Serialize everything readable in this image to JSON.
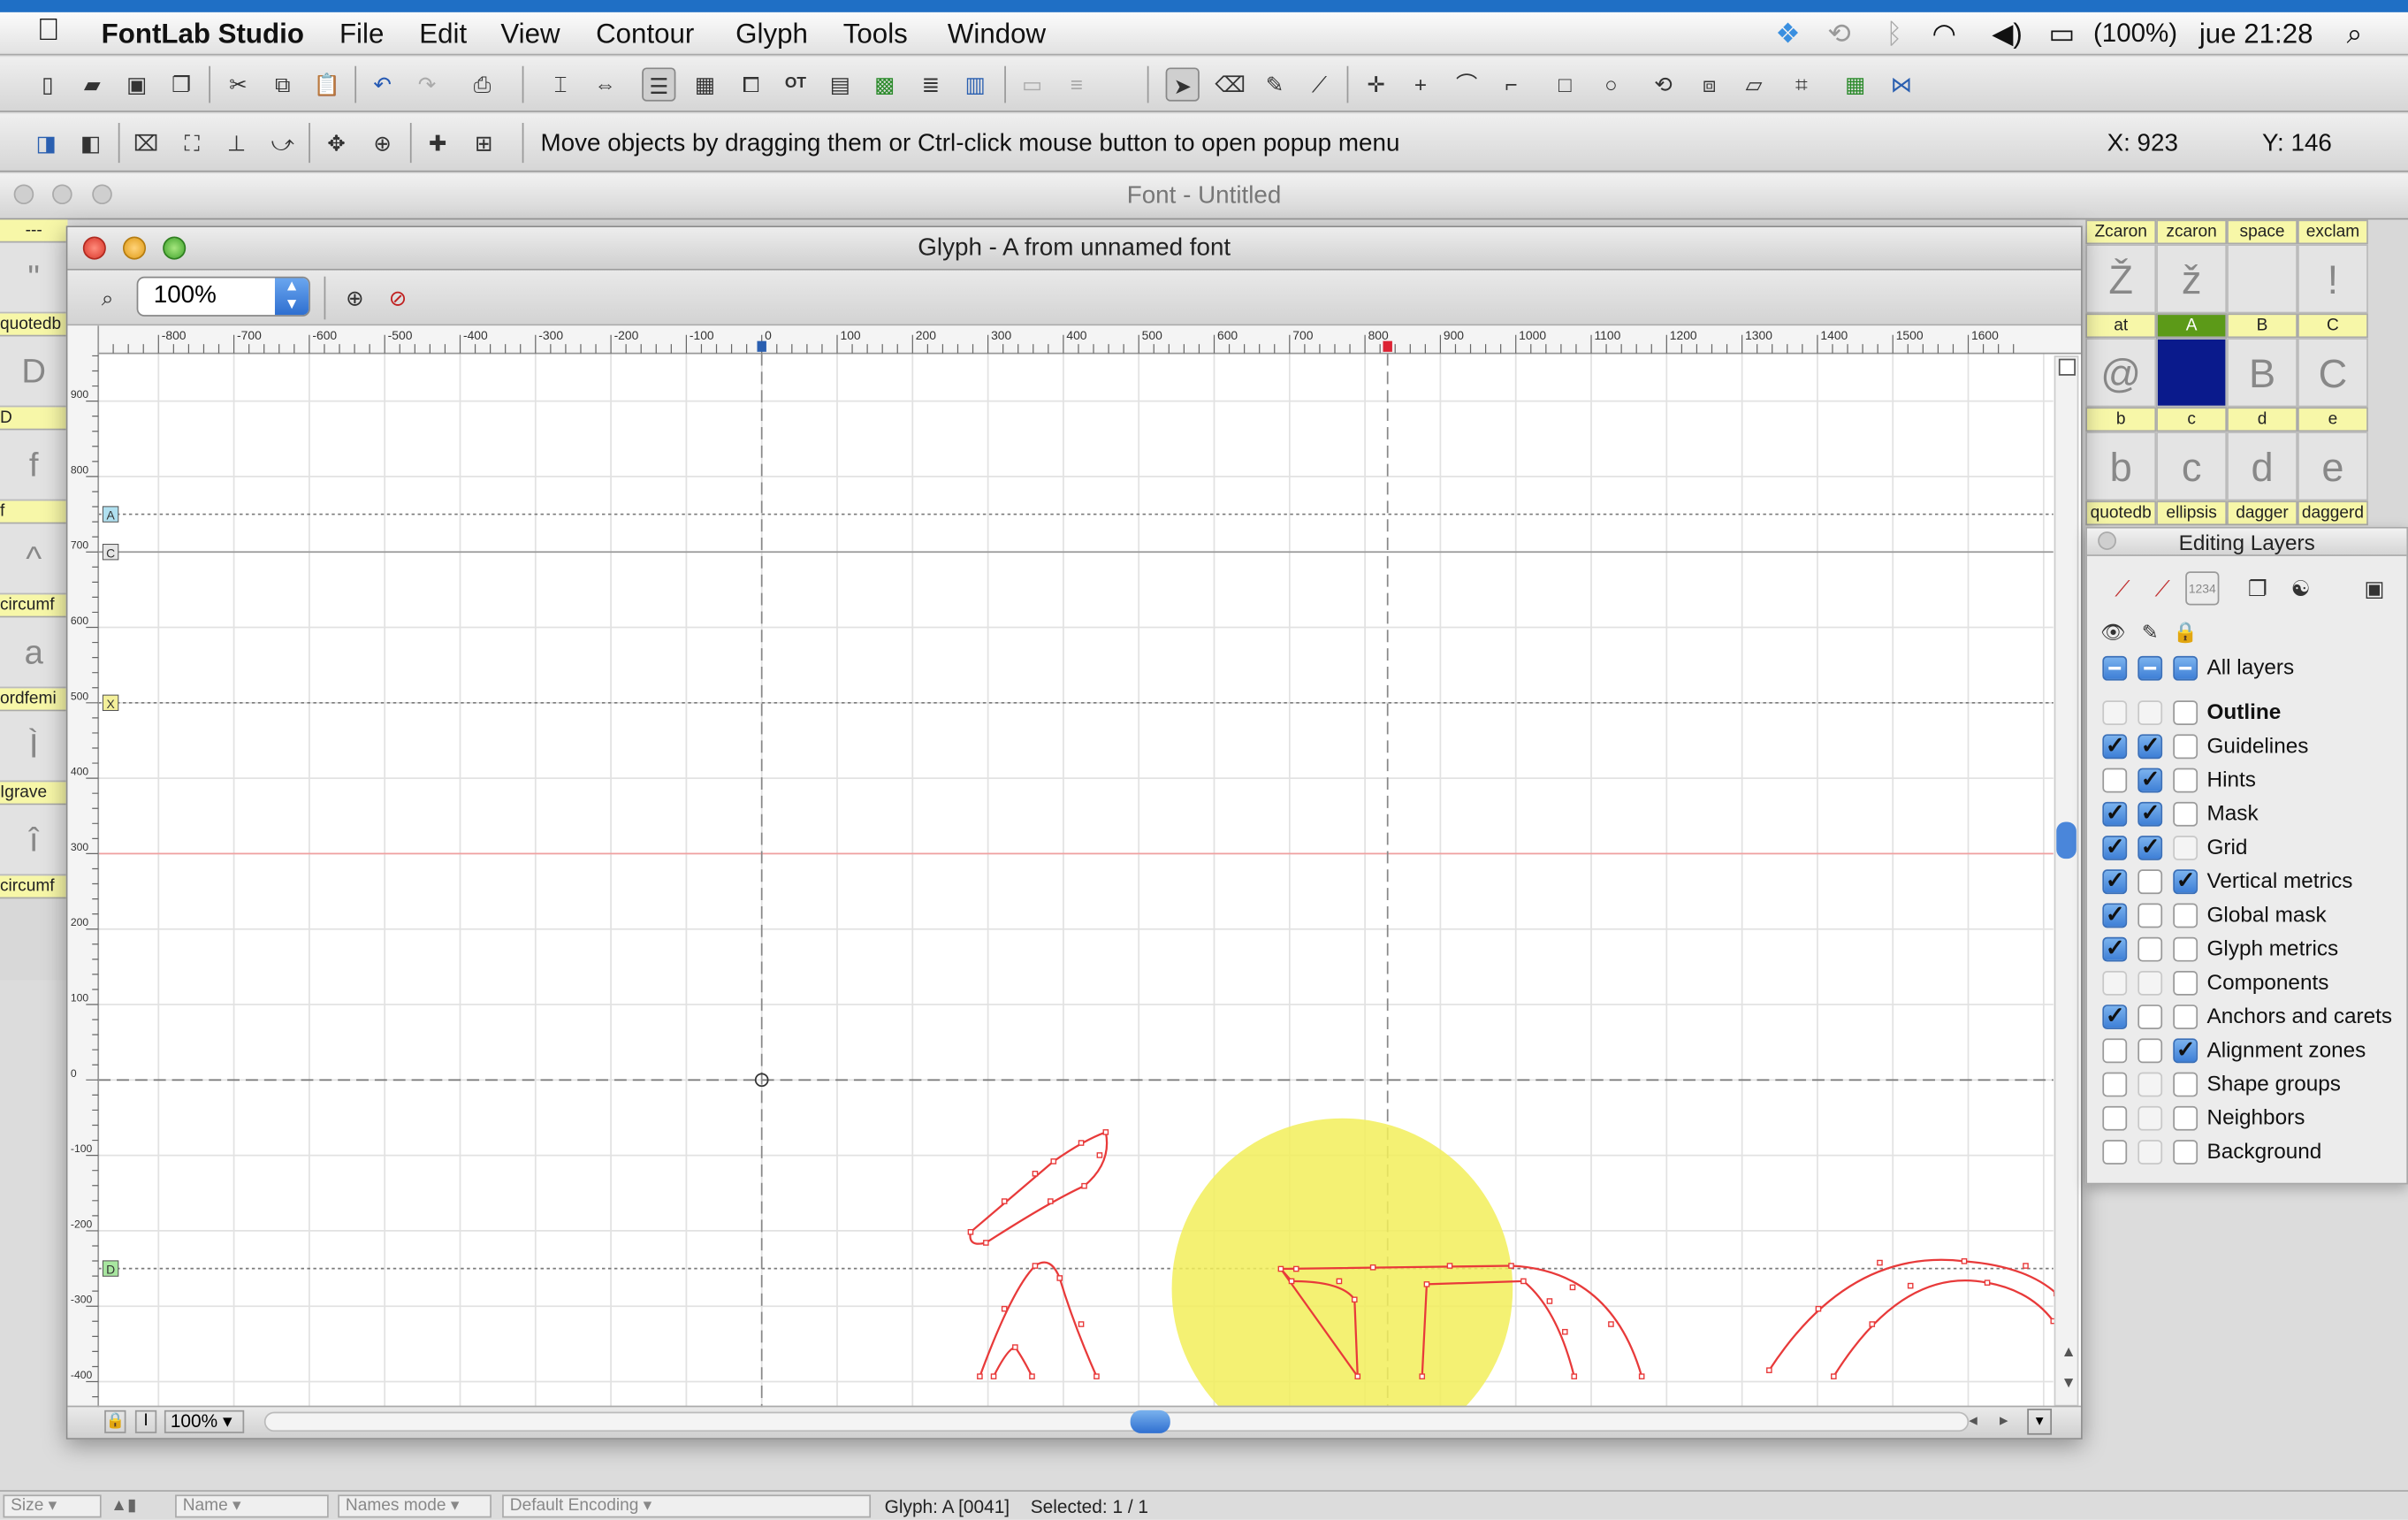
{
  "menubar": {
    "app": "FontLab Studio",
    "items": [
      "File",
      "Edit",
      "View",
      "Contour",
      "Glyph",
      "Tools",
      "Window"
    ],
    "battery": "(100%)",
    "clock": "jue 21:28"
  },
  "toolbar2": {
    "hint": "Move objects by dragging them or Ctrl-click mouse button to open popup menu",
    "x_readout": "X: 923",
    "y_readout": "Y: 146"
  },
  "font_window": {
    "title": "Font - Untitled"
  },
  "glyph_window": {
    "title": "Glyph - A from unnamed font",
    "zoom": "100%",
    "bottom_zoom": "100%",
    "ruler_x_labels": [
      "-800",
      "-700",
      "-600",
      "-500",
      "-400",
      "-300",
      "-200",
      "-100",
      "0",
      "100",
      "200",
      "300",
      "400",
      "500",
      "600",
      "700",
      "800",
      "900",
      "1000",
      "1100",
      "1200",
      "1300",
      "1400",
      "1500",
      "1600"
    ],
    "ruler_y_labels": [
      "900",
      "800",
      "700",
      "600",
      "500",
      "400",
      "300",
      "200",
      "100",
      "0",
      "-100",
      "-200",
      "-300",
      "-400"
    ],
    "zone_markers": [
      "A",
      "C",
      "X",
      "D"
    ]
  },
  "left_strip": {
    "headers": [
      "---",
      "quotedb",
      "D",
      "f",
      "circumf",
      "ordfemi",
      "Igrave",
      "circumf"
    ],
    "glyphs": [
      "\"",
      "D",
      "f",
      "^",
      "a",
      "Ì",
      "î"
    ]
  },
  "right_grid": {
    "row1_headers": [
      "Zcaron",
      "zcaron",
      "space",
      "exclam"
    ],
    "row1_glyphs": [
      "Ž",
      "ž",
      "",
      "!"
    ],
    "row2_headers": [
      "at",
      "A",
      "B",
      "C"
    ],
    "row2_glyphs": [
      "@",
      "",
      "B",
      "C"
    ],
    "row3_headers": [
      "b",
      "c",
      "d",
      "e"
    ],
    "row3_glyphs": [
      "b",
      "c",
      "d",
      "e"
    ],
    "row4_headers": [
      "quotedb",
      "ellipsis",
      "dagger",
      "daggerd"
    ]
  },
  "editing_layers": {
    "title": "Editing Layers",
    "all_label": "All layers",
    "rows": [
      {
        "label": "Outline",
        "v": "dim",
        "e": "dim",
        "l": "off",
        "bold": true
      },
      {
        "label": "Guidelines",
        "v": "on",
        "e": "on",
        "l": "off"
      },
      {
        "label": "Hints",
        "v": "off",
        "e": "on",
        "l": "off"
      },
      {
        "label": "Mask",
        "v": "on",
        "e": "on",
        "l": "off"
      },
      {
        "label": "Grid",
        "v": "on",
        "e": "on",
        "l": "dim"
      },
      {
        "label": "Vertical metrics",
        "v": "on",
        "e": "off",
        "l": "on"
      },
      {
        "label": "Global mask",
        "v": "on",
        "e": "off",
        "l": "off"
      },
      {
        "label": "Glyph metrics",
        "v": "on",
        "e": "off",
        "l": "off"
      },
      {
        "label": "Components",
        "v": "dim",
        "e": "dim",
        "l": "off"
      },
      {
        "label": "Anchors and carets",
        "v": "on",
        "e": "off",
        "l": "off"
      },
      {
        "label": "Alignment zones",
        "v": "off",
        "e": "off",
        "l": "on"
      },
      {
        "label": "Shape groups",
        "v": "off",
        "e": "dim",
        "l": "off"
      },
      {
        "label": "Neighbors",
        "v": "off",
        "e": "dim",
        "l": "off"
      },
      {
        "label": "Background",
        "v": "off",
        "e": "dim",
        "l": "off"
      }
    ]
  },
  "statusbar": {
    "size": "Size",
    "name": "Name",
    "names_mode": "Names mode",
    "encoding": "Default Encoding",
    "glyph_info": "Glyph: A [0041]",
    "selected": "Selected: 1 / 1"
  },
  "colors": {
    "outline": "#e83a3a",
    "highlight": "#f2ef5a",
    "selection": "#0a1a8c"
  }
}
